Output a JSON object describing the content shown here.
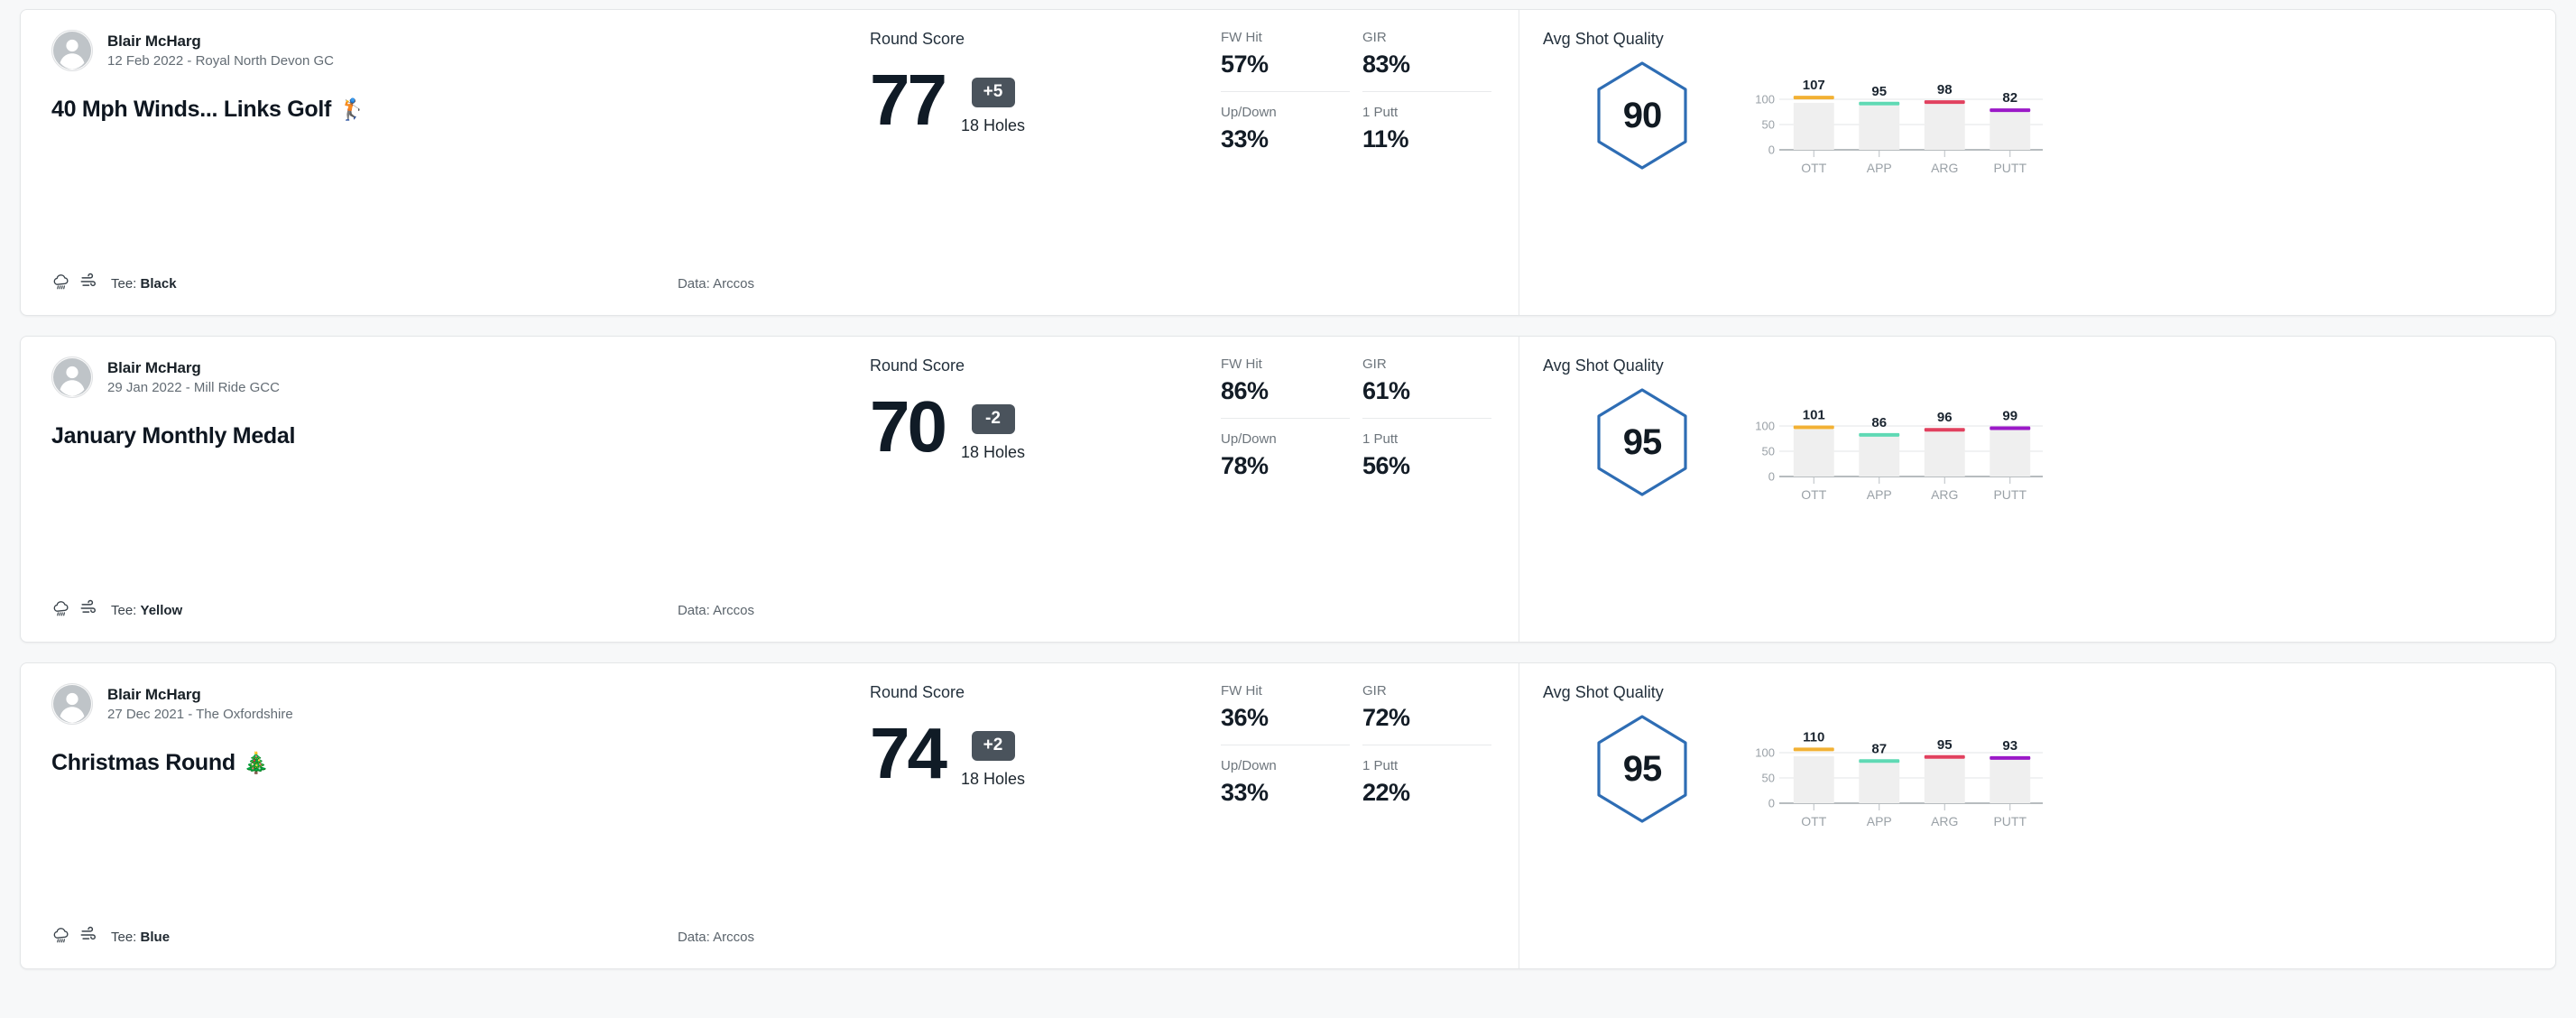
{
  "labels": {
    "round_score": "Round Score",
    "avg_shot_quality": "Avg Shot Quality",
    "tee_prefix": "Tee: ",
    "holes": "18 Holes"
  },
  "colors": {
    "accent_hex": "#2E6DB4",
    "badge_bg": "#4A535C",
    "bar_ott": "#F2B134",
    "bar_app": "#5FD9B4",
    "bar_arg": "#E1415F",
    "bar_putt": "#9B19C8",
    "bar_body": "#EFEFEF",
    "page_bg": "#F7F8F9"
  },
  "rounds": [
    {
      "player": "Blair McHarg",
      "meta": "12 Feb 2022 - Royal North Devon GC",
      "title": "40 Mph Winds... Links Golf",
      "title_emoji": "🏌️",
      "weather_icons": [
        "rain-cloud-icon",
        "wind-icon"
      ],
      "tee": "Black",
      "data_source": "Data: Arccos",
      "score": "77",
      "to_par": "+5",
      "holes": "18 Holes",
      "stats": [
        {
          "label": "FW Hit",
          "value": "57%"
        },
        {
          "label": "GIR",
          "value": "83%"
        },
        {
          "label": "Up/Down",
          "value": "33%"
        },
        {
          "label": "1 Putt",
          "value": "11%"
        }
      ],
      "shot_quality": "90",
      "chart_data": {
        "type": "bar",
        "title": "Avg Shot Quality",
        "categories": [
          "OTT",
          "APP",
          "ARG",
          "PUTT"
        ],
        "values": [
          107,
          95,
          98,
          82
        ],
        "series": [
          {
            "name": "OTT",
            "value": 107,
            "color": "#F2B134"
          },
          {
            "name": "APP",
            "value": 95,
            "color": "#5FD9B4"
          },
          {
            "name": "ARG",
            "value": 98,
            "color": "#E1415F"
          },
          {
            "name": "PUTT",
            "value": 82,
            "color": "#9B19C8"
          }
        ],
        "yticks": [
          0,
          50,
          100
        ],
        "ylim": [
          0,
          125
        ],
        "xlabel": "",
        "ylabel": "",
        "grid": true,
        "legend": "none"
      }
    },
    {
      "player": "Blair McHarg",
      "meta": "29 Jan 2022 - Mill Ride GCC",
      "title": "January Monthly Medal",
      "title_emoji": "",
      "weather_icons": [
        "rain-cloud-icon",
        "wind-icon"
      ],
      "tee": "Yellow",
      "data_source": "Data: Arccos",
      "score": "70",
      "to_par": "-2",
      "holes": "18 Holes",
      "stats": [
        {
          "label": "FW Hit",
          "value": "86%"
        },
        {
          "label": "GIR",
          "value": "61%"
        },
        {
          "label": "Up/Down",
          "value": "78%"
        },
        {
          "label": "1 Putt",
          "value": "56%"
        }
      ],
      "shot_quality": "95",
      "chart_data": {
        "type": "bar",
        "title": "Avg Shot Quality",
        "categories": [
          "OTT",
          "APP",
          "ARG",
          "PUTT"
        ],
        "values": [
          101,
          86,
          96,
          99
        ],
        "series": [
          {
            "name": "OTT",
            "value": 101,
            "color": "#F2B134"
          },
          {
            "name": "APP",
            "value": 86,
            "color": "#5FD9B4"
          },
          {
            "name": "ARG",
            "value": 96,
            "color": "#E1415F"
          },
          {
            "name": "PUTT",
            "value": 99,
            "color": "#9B19C8"
          }
        ],
        "yticks": [
          0,
          50,
          100
        ],
        "ylim": [
          0,
          125
        ],
        "xlabel": "",
        "ylabel": "",
        "grid": true,
        "legend": "none"
      }
    },
    {
      "player": "Blair McHarg",
      "meta": "27 Dec 2021 - The Oxfordshire",
      "title": "Christmas Round",
      "title_emoji": "🎄",
      "weather_icons": [
        "rain-cloud-icon",
        "wind-icon"
      ],
      "tee": "Blue",
      "data_source": "Data: Arccos",
      "score": "74",
      "to_par": "+2",
      "holes": "18 Holes",
      "stats": [
        {
          "label": "FW Hit",
          "value": "36%"
        },
        {
          "label": "GIR",
          "value": "72%"
        },
        {
          "label": "Up/Down",
          "value": "33%"
        },
        {
          "label": "1 Putt",
          "value": "22%"
        }
      ],
      "shot_quality": "95",
      "chart_data": {
        "type": "bar",
        "title": "Avg Shot Quality",
        "categories": [
          "OTT",
          "APP",
          "ARG",
          "PUTT"
        ],
        "values": [
          110,
          87,
          95,
          93
        ],
        "series": [
          {
            "name": "OTT",
            "value": 110,
            "color": "#F2B134"
          },
          {
            "name": "APP",
            "value": 87,
            "color": "#5FD9B4"
          },
          {
            "name": "ARG",
            "value": 95,
            "color": "#E1415F"
          },
          {
            "name": "PUTT",
            "value": 93,
            "color": "#9B19C8"
          }
        ],
        "yticks": [
          0,
          50,
          100
        ],
        "ylim": [
          0,
          125
        ],
        "xlabel": "",
        "ylabel": "",
        "grid": true,
        "legend": "none"
      }
    }
  ]
}
